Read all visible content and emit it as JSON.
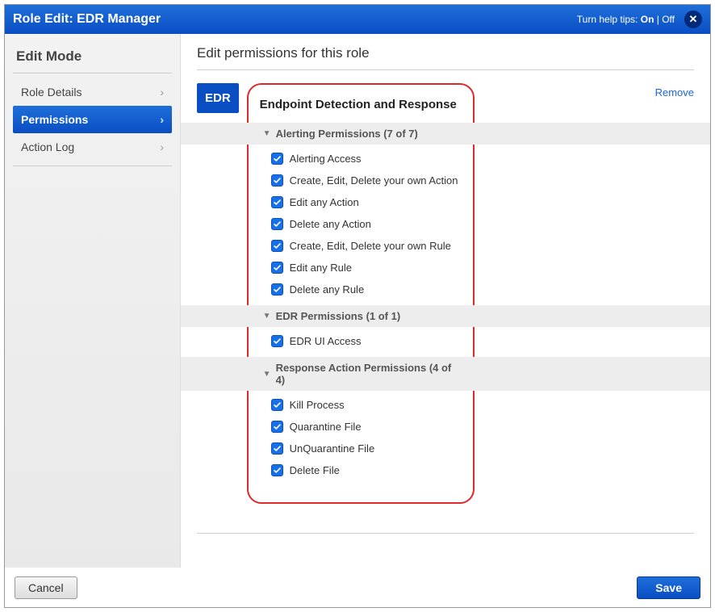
{
  "header": {
    "title": "Role Edit: EDR Manager",
    "help_label": "Turn help tips:",
    "help_on": "On",
    "help_sep": " | ",
    "help_off": "Off"
  },
  "sidebar": {
    "heading": "Edit Mode",
    "items": [
      {
        "label": "Role Details",
        "active": false
      },
      {
        "label": "Permissions",
        "active": true
      },
      {
        "label": "Action Log",
        "active": false
      }
    ]
  },
  "main": {
    "title": "Edit permissions for this role",
    "badge": "EDR",
    "section_title": "Endpoint Detection and Response",
    "remove": "Remove",
    "groups": [
      {
        "header": "Alerting Permissions (7 of 7)",
        "items": [
          "Alerting Access",
          "Create, Edit, Delete your own Action",
          "Edit any Action",
          "Delete any Action",
          "Create, Edit, Delete your own Rule",
          "Edit any Rule",
          "Delete any Rule"
        ]
      },
      {
        "header": "EDR Permissions (1 of 1)",
        "items": [
          "EDR UI Access"
        ]
      },
      {
        "header": "Response Action Permissions (4 of 4)",
        "items": [
          "Kill Process",
          "Quarantine File",
          "UnQuarantine File",
          "Delete File"
        ]
      }
    ]
  },
  "footer": {
    "cancel": "Cancel",
    "save": "Save"
  }
}
